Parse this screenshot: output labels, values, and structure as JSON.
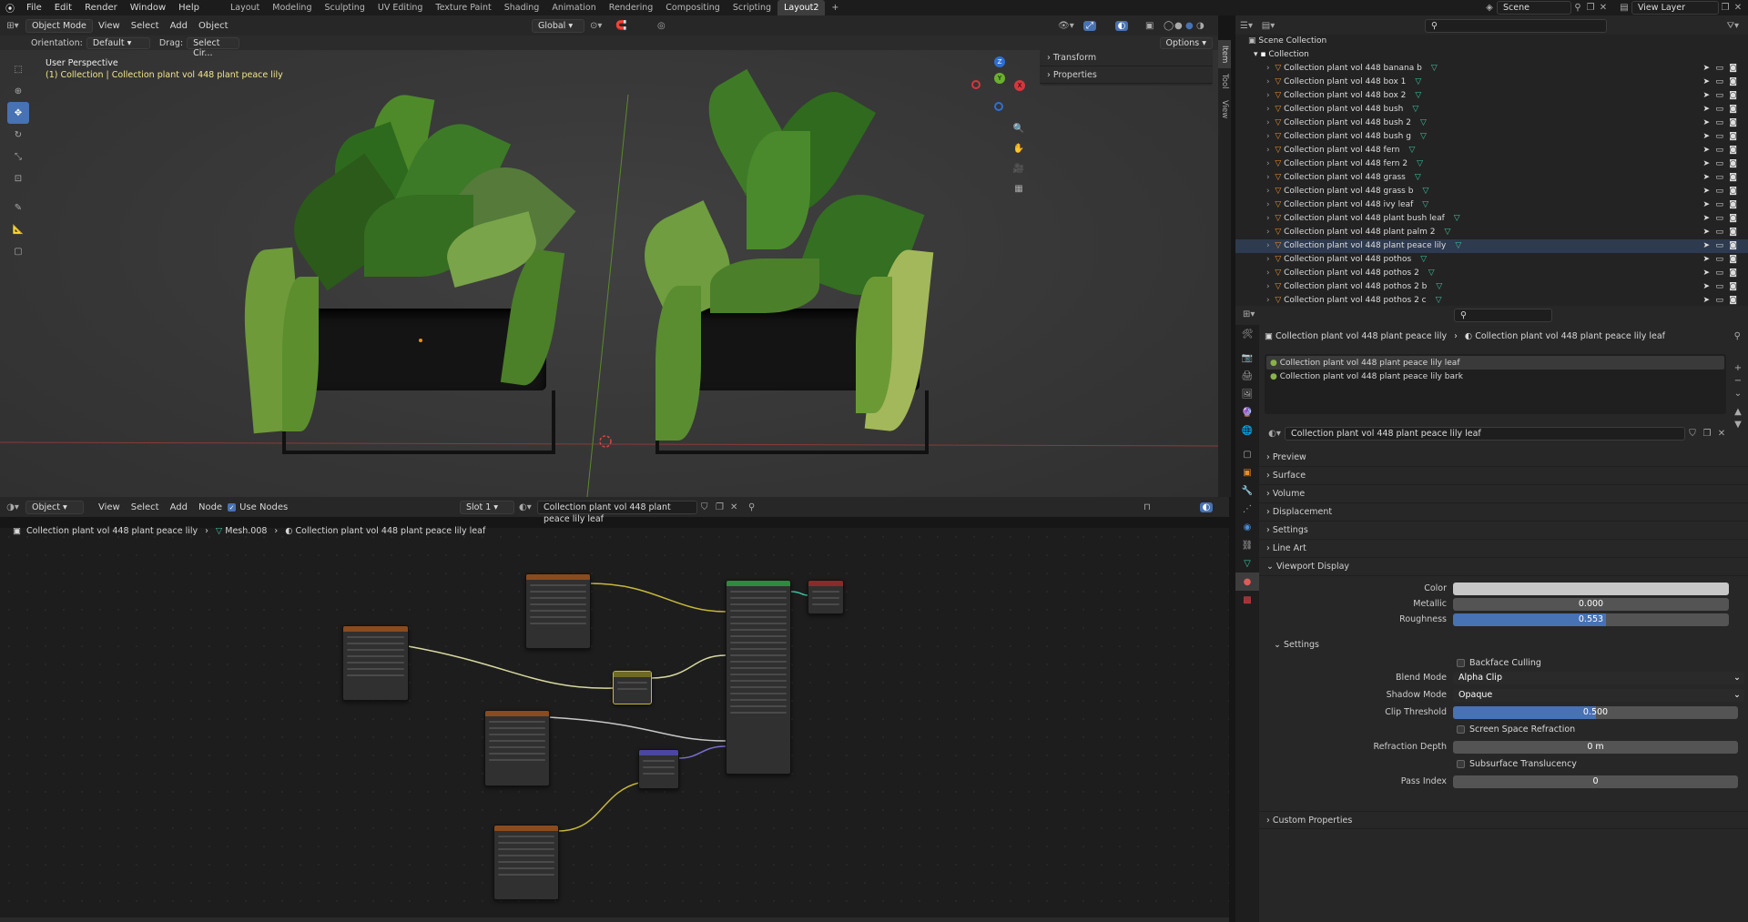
{
  "topbar": {
    "menus": [
      "File",
      "Edit",
      "Render",
      "Window",
      "Help"
    ],
    "workspaces": [
      "Layout",
      "Modeling",
      "Sculpting",
      "UV Editing",
      "Texture Paint",
      "Shading",
      "Animation",
      "Rendering",
      "Compositing",
      "Scripting",
      "Layout2"
    ],
    "active_workspace": "Layout2",
    "add_workspace": "+",
    "scene": "Scene",
    "view_layer": "View Layer"
  },
  "viewport_header": {
    "mode": "Object Mode",
    "menus": [
      "View",
      "Select",
      "Add",
      "Object"
    ],
    "transform_orientation": "Global",
    "orientation_label": "Orientation:",
    "orientation_value": "Default",
    "drag_label": "Drag:",
    "drag_value": "Select Cir...",
    "options": "Options"
  },
  "viewport": {
    "perspective": "User Perspective",
    "collection_info": "(1) Collection | Collection plant vol 448 plant peace lily",
    "gizmo": {
      "z": "Z",
      "y": "Y",
      "x": "X"
    },
    "npanel": {
      "sections": [
        "Transform",
        "Properties"
      ],
      "tabs": [
        "Item",
        "Tool",
        "View"
      ]
    }
  },
  "outliner": {
    "root": "Scene Collection",
    "collection": "Collection",
    "items": [
      "Collection plant vol 448 banana b",
      "Collection plant vol 448 box 1",
      "Collection plant vol 448 box 2",
      "Collection plant vol 448 bush",
      "Collection plant vol 448 bush 2",
      "Collection plant vol 448 bush g",
      "Collection plant vol 448 fern",
      "Collection plant vol 448 fern 2",
      "Collection plant vol 448 grass",
      "Collection plant vol 448 grass b",
      "Collection plant vol 448 ivy leaf",
      "Collection plant vol 448 plant bush leaf",
      "Collection plant vol 448 plant palm 2",
      "Collection plant vol 448 plant peace lily",
      "Collection plant vol 448 pothos",
      "Collection plant vol 448 pothos 2",
      "Collection plant vol 448 pothos 2 b",
      "Collection plant vol 448 pothos 2 c"
    ]
  },
  "properties": {
    "breadcrumb_object": "Collection plant vol 448 plant peace lily",
    "breadcrumb_material": "Collection plant vol 448 plant peace lily leaf",
    "slots": [
      "Collection plant vol 448 plant peace lily leaf",
      "Collection plant vol 448 plant peace lily bark"
    ],
    "material_name": "Collection plant vol 448 plant peace lily leaf",
    "sections": [
      "Preview",
      "Surface",
      "Volume",
      "Displacement",
      "Settings",
      "Line Art",
      "Viewport Display"
    ],
    "viewport_display": {
      "color_label": "Color",
      "metallic_label": "Metallic",
      "metallic": "0.000",
      "metallic_fill": 0.0,
      "roughness_label": "Roughness",
      "roughness": "0.553",
      "roughness_fill": 0.553
    },
    "settings": {
      "title": "Settings",
      "backface_culling": "Backface Culling",
      "blend_mode_label": "Blend Mode",
      "blend_mode": "Alpha Clip",
      "shadow_mode_label": "Shadow Mode",
      "shadow_mode": "Opaque",
      "clip_threshold_label": "Clip Threshold",
      "clip_threshold": "0.500",
      "clip_threshold_fill": 0.5,
      "screen_space_refraction": "Screen Space Refraction",
      "refraction_depth_label": "Refraction Depth",
      "refraction_depth": "0 m",
      "subsurface_translucency": "Subsurface Translucency",
      "pass_index_label": "Pass Index",
      "pass_index": "0"
    },
    "custom_properties": "Custom Properties"
  },
  "node_editor": {
    "type": "Object",
    "menus": [
      "View",
      "Select",
      "Add",
      "Node"
    ],
    "use_nodes": "Use Nodes",
    "slot": "Slot 1",
    "material": "Collection plant vol 448 plant peace lily leaf",
    "breadcrumb": [
      "Collection plant vol 448 plant peace lily",
      "Mesh.008",
      "Collection plant vol 448 plant peace lily leaf"
    ]
  },
  "colors": {
    "accent": "#4772b3",
    "collection_info": "#f0e68a",
    "viewport_display_color": "#c8c8c8"
  }
}
